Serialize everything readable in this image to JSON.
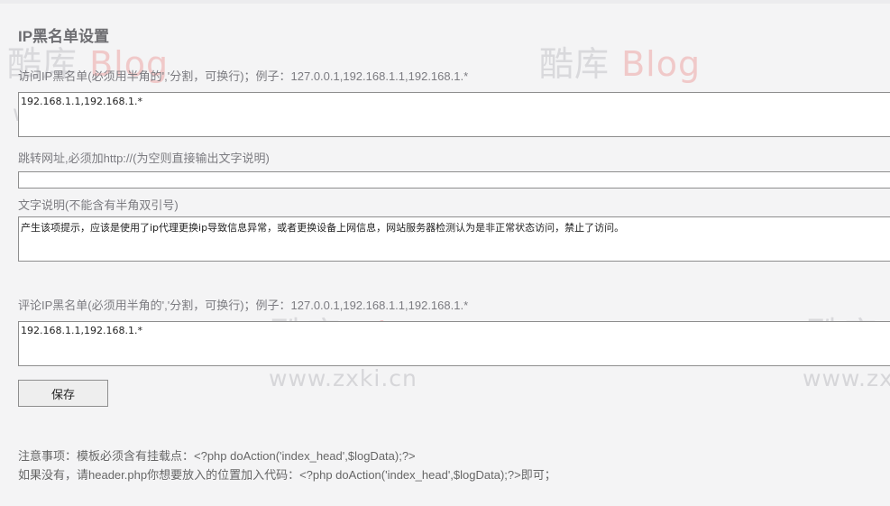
{
  "page": {
    "title": "IP黑名单设置"
  },
  "watermark": {
    "brand_cn": "酷库",
    "brand_en": "Blog",
    "url": "www.zxki.cn"
  },
  "visit_blacklist": {
    "label": "访问IP黑名单(必须用半角的','分割，可换行)；例子：127.0.0.1,192.168.1.1,192.168.1.*",
    "value": "192.168.1.1,192.168.1.*"
  },
  "redirect": {
    "label": "跳转网址,必须加http://(为空则直接输出文字说明)",
    "value": ""
  },
  "message": {
    "label": "文字说明(不能含有半角双引号)",
    "value": "产生该项提示，应该是使用了ip代理更换ip导致信息异常，或者更换设备上网信息，网站服务器检测认为是非正常状态访问，禁止了访问。"
  },
  "comment_blacklist": {
    "label": "评论IP黑名单(必须用半角的','分割，可换行)；例子：127.0.0.1,192.168.1.1,192.168.1.*",
    "value": "192.168.1.1,192.168.1.*"
  },
  "save_button": {
    "label": "保存"
  },
  "notes": {
    "line1": "注意事项：模板必须含有挂载点：<?php doAction('index_head',$logData);?>",
    "line2": "如果没有，请header.php你想要放入的位置加入代码：<?php doAction('index_head',$logData);?>即可；"
  }
}
